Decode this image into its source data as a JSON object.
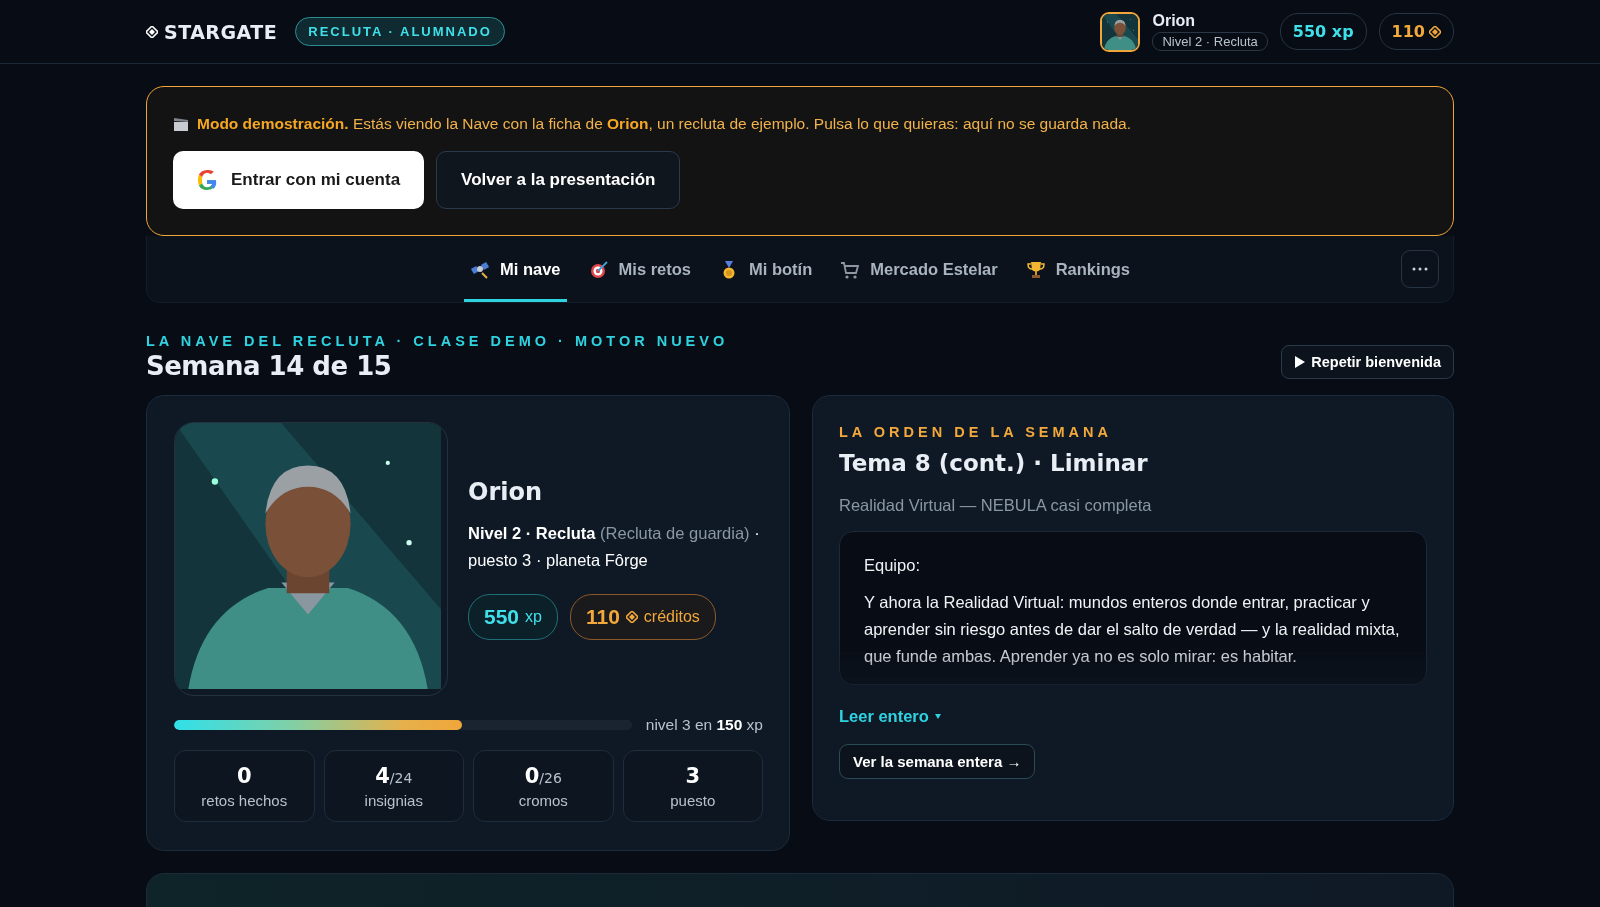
{
  "header": {
    "logo": "STARGATE",
    "role_badge": "RECLUTA · ALUMNADO",
    "user": {
      "name": "Orion",
      "level": "Nivel 2 · Recluta"
    },
    "xp_pill": "550 xp",
    "credits_pill": "110"
  },
  "demo_banner": {
    "text": "**Modo demostración.** Estás viendo la Nave con la ficha de **Orion**, un recluta de ejemplo. Pulsa lo que quieras: aquí no se guarda nada.",
    "buttons": [
      {
        "kind": "google",
        "label": "Entrar con mi cuenta"
      },
      {
        "kind": "outline",
        "label": "Volver a la presentación"
      }
    ]
  },
  "tabs": [
    {
      "label": "Mi nave",
      "selected": true
    },
    {
      "label": "Mis retos",
      "selected": false
    },
    {
      "label": "Mi botín",
      "selected": false
    },
    {
      "label": "Mercado Estelar",
      "selected": false
    },
    {
      "label": "Rankings",
      "selected": false
    }
  ],
  "page": {
    "eyebrow": "LA NAVE DEL RECLUTA · CLASE DEMO · MOTOR NUEVO",
    "title": "Semana 14 de 15",
    "replay_button": "Repetir bienvenida"
  },
  "profile": {
    "name": "Orion",
    "rank": "Nivel 2 · Recluta",
    "rank_note": "(Recluta de guardia)",
    "details": "· puesto 3 · planeta Fôrge",
    "xp_value": "550",
    "xp_unit": "xp",
    "credits_value": "110",
    "credits_unit": "créditos",
    "progress": {
      "level": 0.63,
      "caption": "nivel 3 en **150** xp"
    },
    "stats": [
      {
        "value": "0",
        "label": "retos hechos"
      },
      {
        "value": "4",
        "total": "/24",
        "label": "insignias"
      },
      {
        "value": "0",
        "total": "/26",
        "label": "cromos"
      },
      {
        "value": "3",
        "label": "puesto"
      }
    ]
  },
  "weekly_order": {
    "eyebrow": "LA ORDEN DE LA SEMANA",
    "title": "Tema 8 (cont.) · Liminar",
    "subtitle": "Realidad Virtual — NEBULA casi completa",
    "excerpt": [
      "Equipo:",
      "Y ahora la Realidad Virtual: mundos enteros donde entrar, practicar y aprender sin riesgo antes de dar el salto de verdad — y la realidad mixta, que funde ambas. Aprender ya no es solo mirar: es habitar."
    ],
    "read_more": "Leer entero",
    "week_button": "Ver la semana entera →"
  }
}
